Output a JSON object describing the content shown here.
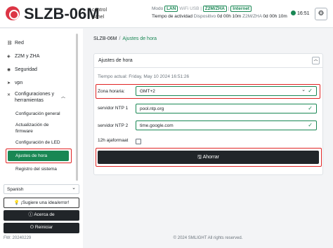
{
  "header": {
    "title": "SLZB-06M",
    "subtitle": "control panel",
    "mode_label": "Modo",
    "mode_lan": "LAN",
    "mode_wifi": "WiFi",
    "mode_usb": "USB",
    "mode_sep": "|",
    "mode_z2m": "Z2M/ZHA",
    "mode_internet": "Internet",
    "uptime_label": "Tiempo de actividad",
    "device_label": "Dispositivo",
    "device_uptime": "0d 00h 10m",
    "z2m_label": "Z2M/ZHA",
    "z2m_uptime": "0d 00h 10m",
    "clock": "16:51",
    "theme_icon": "gear-icon"
  },
  "sidebar": {
    "items": [
      {
        "label": "Red",
        "icon": "network-icon"
      },
      {
        "label": "Z2M y ZHA",
        "icon": "zigbee-icon"
      },
      {
        "label": "Seguridad",
        "icon": "shield-icon"
      },
      {
        "label": "vpn",
        "icon": "vpn-icon"
      },
      {
        "label": "Configuraciones y herramientas",
        "icon": "tools-icon"
      }
    ],
    "sub_items": [
      {
        "label": "Configuración general"
      },
      {
        "label": "Actualización de firmware"
      },
      {
        "label": "Configuración de LED"
      },
      {
        "label": "Ajustes de hora"
      },
      {
        "label": "Registro del sistema"
      }
    ],
    "language": "Spanish",
    "suggest_button": "¡Sugiere una idea/error!",
    "about_button": "Acerca de",
    "restart_button": "Reiniciar",
    "fw": "FW: 20240229"
  },
  "breadcrumb": {
    "root": "SLZB-06M",
    "sep": "/",
    "current": "Ajustes de hora"
  },
  "card": {
    "title": "Ajustes de hora",
    "current_time_label": "Tiempo actual:",
    "current_time_value": "Friday, May 10 2024 16:51:26",
    "timezone_label": "Zona horaria:",
    "timezone_value": "GMT+2",
    "ntp1_label": "servidor NTP 1",
    "ntp1_value": "pool.ntp.org",
    "ntp2_label": "servidor NTP 2",
    "ntp2_value": "time.google.com",
    "format12h_label": "12h ajaformaat",
    "save_button": "Ahorrar"
  },
  "footer": {
    "text": "© 2024 SMLIGHT All rights reserved."
  },
  "colors": {
    "accent": "#198754",
    "highlight": "#e02424",
    "dark": "#212529"
  }
}
